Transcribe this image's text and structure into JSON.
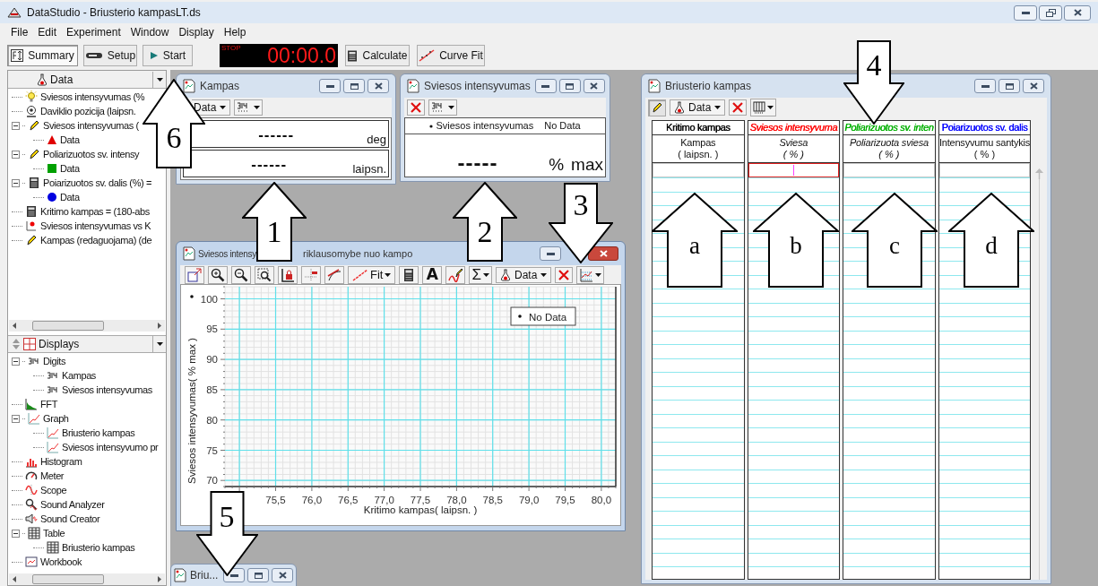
{
  "app": {
    "title": "DataStudio - Briusterio kampasLT.ds"
  },
  "menu": [
    {
      "label": "File"
    },
    {
      "label": "Edit"
    },
    {
      "label": "Experiment"
    },
    {
      "label": "Window"
    },
    {
      "label": "Display"
    },
    {
      "label": "Help"
    }
  ],
  "toolbar": [
    {
      "kind": "button",
      "label": "Summary",
      "selected": true
    },
    {
      "kind": "button",
      "label": "Setup",
      "selected": false
    },
    {
      "kind": "button",
      "label": "Start",
      "selected": false
    },
    {
      "kind": "timer",
      "status": "STOP",
      "time": "00:00.0"
    },
    {
      "kind": "button",
      "label": "Calculate",
      "selected": false
    },
    {
      "kind": "button",
      "label": "Curve Fit",
      "selected": false
    }
  ],
  "data_panel": {
    "header": "Data",
    "items": [
      {
        "label": "Sviesos intensyvumas (%",
        "kind": "bulb"
      },
      {
        "label": "Daviklio pozicija (laipsn.",
        "kind": "sensor"
      },
      {
        "label": "Sviesos intensyvumas (",
        "kind": "pencil",
        "expanded": true,
        "children": [
          {
            "label": "Data",
            "kind": "triangle",
            "color": "#e00000"
          }
        ]
      },
      {
        "label": "Poliarizuotos sv. intensy",
        "kind": "pencil",
        "expanded": true,
        "children": [
          {
            "label": "Data",
            "kind": "square",
            "color": "#00a000"
          }
        ]
      },
      {
        "label": "Poiarizuotos sv. dalis (%) =",
        "kind": "calculator",
        "expanded": true,
        "children": [
          {
            "label": "Data",
            "kind": "circle",
            "color": "#0000e0"
          }
        ]
      },
      {
        "label": "Kritimo kampas = (180-abs",
        "kind": "calculator"
      },
      {
        "label": "Sviesos intensyvumas vs K",
        "kind": "scatter"
      },
      {
        "label": "Kampas (redaguojama) (de",
        "kind": "pencil"
      }
    ]
  },
  "displays_panel": {
    "header": "Displays",
    "items": [
      {
        "label": "Digits",
        "kind": "digits",
        "expanded": true,
        "children": [
          {
            "label": "Kampas",
            "kind": "digits"
          },
          {
            "label": "Sviesos intensyvumas",
            "kind": "digits"
          }
        ]
      },
      {
        "label": "FFT",
        "kind": "fft"
      },
      {
        "label": "Graph",
        "kind": "graph",
        "expanded": true,
        "children": [
          {
            "label": "Briusterio kampas",
            "kind": "graph"
          },
          {
            "label": "Sviesos intensyvumo pr",
            "kind": "graph"
          }
        ]
      },
      {
        "label": "Histogram",
        "kind": "histogram"
      },
      {
        "label": "Meter",
        "kind": "meter"
      },
      {
        "label": "Scope",
        "kind": "scope"
      },
      {
        "label": "Sound Analyzer",
        "kind": "analyzer"
      },
      {
        "label": "Sound Creator",
        "kind": "speaker"
      },
      {
        "label": "Table",
        "kind": "table",
        "expanded": true,
        "children": [
          {
            "label": "Briusterio kampas",
            "kind": "table"
          }
        ]
      },
      {
        "label": "Workbook",
        "kind": "workbook"
      }
    ]
  },
  "kampas_window": {
    "title": "Kampas",
    "active": false,
    "data_label": "Data",
    "readings": [
      {
        "value": "------",
        "unit": "deg"
      },
      {
        "value": "------",
        "unit": "laipsn."
      }
    ]
  },
  "intensity_window": {
    "title": "Sviesos intensyvumas",
    "active": false,
    "legend": "Sviesos intensyvumas",
    "status": "No Data",
    "value": "-----",
    "unit": "%",
    "unit_2": "max"
  },
  "graph_window": {
    "title_parts": [
      "Sviesos intensy",
      "riklausomybe nuo kampo"
    ],
    "active": true,
    "toolbar": {
      "fit_label": "Fit",
      "annotation_glyph": "A",
      "sigma_glyph": "Σ",
      "data_label": "Data"
    },
    "legend": "No Data",
    "chart_data": {
      "type": "scatter",
      "grid": true,
      "xlabel": "Kritimo kampas( laipsn. )",
      "ylabel": "Sviesos intensyvumas( % max )",
      "xlim": [
        74.8,
        80.2
      ],
      "ylim": [
        69,
        102
      ],
      "xticks": [
        {
          "value": 75.5,
          "label": "75,5"
        },
        {
          "value": 76,
          "label": "76,0"
        },
        {
          "value": 76.5,
          "label": "76,5"
        },
        {
          "value": 77,
          "label": "77,0"
        },
        {
          "value": 77.5,
          "label": "77,5"
        },
        {
          "value": 78,
          "label": "78,0"
        },
        {
          "value": 78.5,
          "label": "78,5"
        },
        {
          "value": 79,
          "label": "79,0"
        },
        {
          "value": 79.5,
          "label": "79,5"
        },
        {
          "value": 80,
          "label": "80,0"
        }
      ],
      "yticks": [
        70,
        75,
        80,
        85,
        90,
        95,
        100
      ]
    }
  },
  "minimized_window": {
    "title": "Briu..."
  },
  "table_window": {
    "title": "Briusterio kampas",
    "active": false,
    "data_label": "Data",
    "columns": [
      {
        "source": "Kritimo kampas",
        "color": "#000000",
        "name": "Kampas",
        "unit": "( laipsn. )",
        "italic": false,
        "selected": false
      },
      {
        "source": "Sviesos intensyvuma",
        "color": "#ff0000",
        "name": "Sviesa",
        "unit": "( % )",
        "italic": true,
        "selected": true
      },
      {
        "source": "Poliarizuotos sv. inten",
        "color": "#00b000",
        "name": "Poliarizuota sviesa",
        "unit": "( % )",
        "italic": true,
        "selected": false
      },
      {
        "source": "Poiarizuotos sv. dalis",
        "color": "#0000ff",
        "name": "Intensyvumu santykis",
        "unit": "( % )",
        "italic": false,
        "selected": false
      }
    ]
  },
  "callouts": [
    {
      "label": "6",
      "kind": "up"
    },
    {
      "label": "1",
      "kind": "up"
    },
    {
      "label": "2",
      "kind": "up"
    },
    {
      "label": "3",
      "kind": "down"
    },
    {
      "label": "4",
      "kind": "down"
    },
    {
      "label": "5",
      "kind": "down"
    },
    {
      "label": "a",
      "kind": "up"
    },
    {
      "label": "b",
      "kind": "up"
    },
    {
      "label": "c",
      "kind": "up"
    },
    {
      "label": "d",
      "kind": "up"
    }
  ]
}
